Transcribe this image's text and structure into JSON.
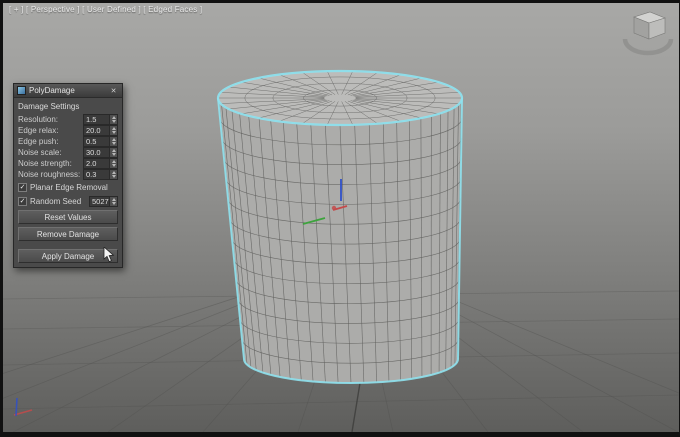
{
  "viewport": {
    "label": "[ + ] [ Perspective ] [ User Defined ] [ Edged Faces ]"
  },
  "dialog": {
    "title": "PolyDamage",
    "close_label": "✕",
    "check_glyph": "✓",
    "section_title": "Damage Settings",
    "fields": [
      {
        "label": "Resolution:",
        "value": "1.5"
      },
      {
        "label": "Edge relax:",
        "value": "20.0"
      },
      {
        "label": "Edge push:",
        "value": "0.5"
      },
      {
        "label": "Noise scale:",
        "value": "30.0"
      },
      {
        "label": "Noise strength:",
        "value": "2.0"
      },
      {
        "label": "Noise roughness:",
        "value": "0.3"
      }
    ],
    "checkboxes": [
      {
        "label": "Planar Edge Removal",
        "checked": true
      },
      {
        "label": "Random Seed",
        "checked": true,
        "value": "5027"
      }
    ],
    "buttons": [
      "Reset Values",
      "Remove Damage"
    ],
    "apply_button": "Apply Damage"
  },
  "colors": {
    "selection": "#8fe2ee",
    "wire": "#5e5e5c",
    "mesh": "#acacaa",
    "mesh_top": "#bcbcba",
    "grid": "#50504e",
    "gizmo_x": "#c44a4a",
    "gizmo_y": "#3da33d",
    "gizmo_z": "#3050c8"
  }
}
